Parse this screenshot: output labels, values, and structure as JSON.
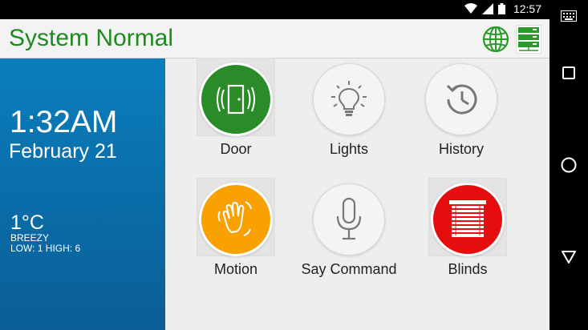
{
  "status_bar": {
    "time": "12:57"
  },
  "header": {
    "title": "System Normal"
  },
  "side_panel": {
    "time": "1:32AM",
    "date": "February 21",
    "temperature": "1°C",
    "condition": "BREEZY",
    "low_high": "LOW: 1 HIGH: 6"
  },
  "tiles": [
    {
      "label": "Door",
      "icon": "door-icon",
      "color": "#2a8c28"
    },
    {
      "label": "Lights",
      "icon": "lightbulb-icon",
      "color": "#f4f4f4"
    },
    {
      "label": "History",
      "icon": "history-icon",
      "color": "#f4f4f4"
    },
    {
      "label": "Motion",
      "icon": "motion-hand-icon",
      "color": "#f8a100"
    },
    {
      "label": "Say Command",
      "icon": "microphone-icon",
      "color": "#f4f4f4"
    },
    {
      "label": "Blinds",
      "icon": "blinds-icon",
      "color": "#e50d0d"
    }
  ],
  "colors": {
    "accent": "#1f8a1f",
    "panel": "#0a6fab"
  }
}
